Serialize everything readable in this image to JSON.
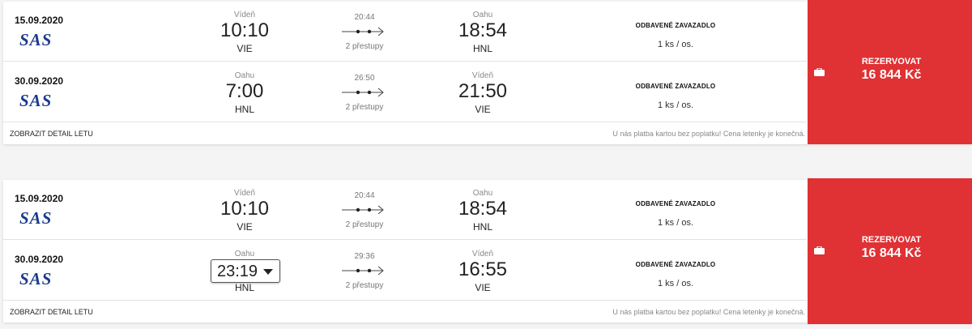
{
  "results": [
    {
      "legs": [
        {
          "date": "15.09.2020",
          "airline": "SAS",
          "dep_city": "Vídeň",
          "dep_time": "10:10",
          "dep_code": "VIE",
          "duration": "20:44",
          "stops": "2 přestupy",
          "arr_city": "Oahu",
          "arr_time": "18:54",
          "arr_code": "HNL",
          "baggage_title": "ODBAVENÉ ZAVAZADLO",
          "baggage_count": "1 ks / os."
        },
        {
          "date": "30.09.2020",
          "airline": "SAS",
          "dep_city": "Oahu",
          "dep_time": "7:00",
          "dep_code": "HNL",
          "duration": "26:50",
          "stops": "2 přestupy",
          "arr_city": "Vídeň",
          "arr_time": "21:50",
          "arr_code": "VIE",
          "baggage_title": "ODBAVENÉ ZAVAZADLO",
          "baggage_count": "1 ks / os."
        }
      ],
      "detail_link": "ZOBRAZIT DETAIL LETU",
      "note": "U nás platba kartou bez poplatku! Cena letenky je konečná.",
      "book_label": "REZERVOVAT",
      "price": "16 844 Kč"
    },
    {
      "legs": [
        {
          "date": "15.09.2020",
          "airline": "SAS",
          "dep_city": "Vídeň",
          "dep_time": "10:10",
          "dep_code": "VIE",
          "duration": "20:44",
          "stops": "2 přestupy",
          "arr_city": "Oahu",
          "arr_time": "18:54",
          "arr_code": "HNL",
          "baggage_title": "ODBAVENÉ ZAVAZADLO",
          "baggage_count": "1 ks / os."
        },
        {
          "date": "30.09.2020",
          "airline": "SAS",
          "dep_city": "Oahu",
          "dep_time": "23:19",
          "dep_code": "HNL",
          "duration": "29:36",
          "stops": "2 přestupy",
          "arr_city": "Vídeň",
          "arr_time": "16:55",
          "arr_code": "VIE",
          "baggage_title": "ODBAVENÉ ZAVAZADLO",
          "baggage_count": "1 ks / os."
        }
      ],
      "detail_link": "ZOBRAZIT DETAIL LETU",
      "note": "U nás platba kartou bez poplatku! Cena letenky je konečná.",
      "book_label": "REZERVOVAT",
      "price": "16 844 Kč"
    }
  ],
  "icons": {
    "route": "route-arrow-icon",
    "bag": "suitcase-icon",
    "caret": "chevron-down-icon"
  },
  "colors": {
    "book_bg": "#e03134",
    "airline": "#1a3a8f"
  }
}
